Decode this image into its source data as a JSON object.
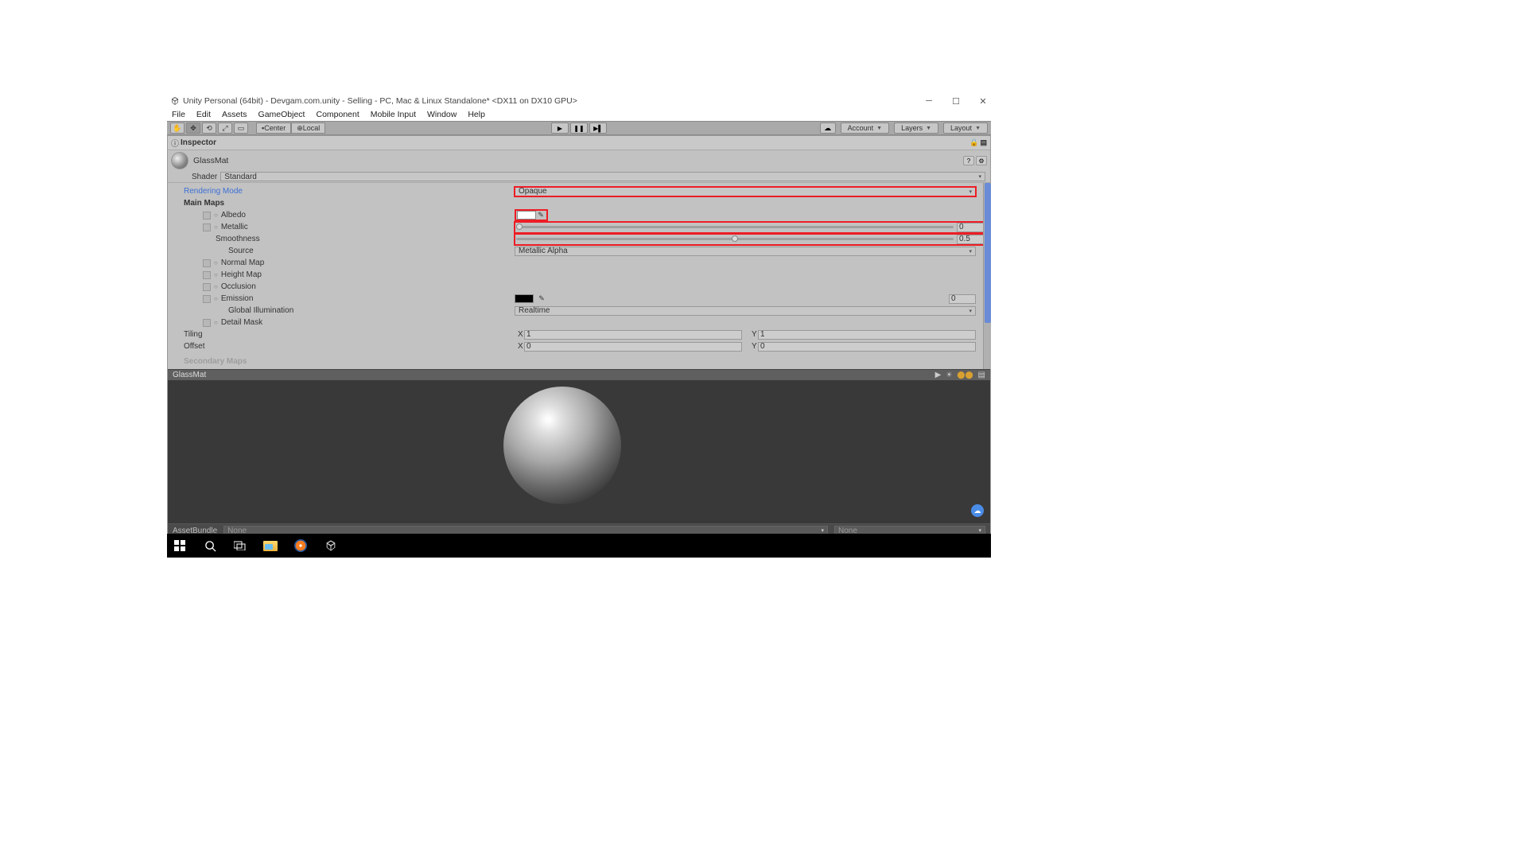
{
  "window": {
    "title": "Unity Personal (64bit) - Devgam.com.unity - Selling - PC, Mac & Linux Standalone* <DX11 on DX10 GPU>"
  },
  "menubar": [
    "File",
    "Edit",
    "Assets",
    "GameObject",
    "Component",
    "Mobile Input",
    "Window",
    "Help"
  ],
  "toolbar": {
    "center": "Center",
    "local": "Local",
    "account": "Account",
    "layers": "Layers",
    "layout": "Layout"
  },
  "inspector": {
    "title": "Inspector",
    "material_name": "GlassMat",
    "shader_label": "Shader",
    "shader_value": "Standard",
    "rendering_mode_label": "Rendering Mode",
    "rendering_mode_value": "Opaque",
    "main_maps": "Main Maps",
    "albedo": "Albedo",
    "albedo_color": "#ffffff",
    "metallic": "Metallic",
    "metallic_value": "0",
    "smoothness": "Smoothness",
    "smoothness_value": "0.5",
    "source": "Source",
    "source_value": "Metallic Alpha",
    "normal_map": "Normal Map",
    "height_map": "Height Map",
    "occlusion": "Occlusion",
    "emission": "Emission",
    "emission_color": "#000000",
    "emission_value": "0",
    "global_illumination": "Global Illumination",
    "global_illumination_value": "Realtime",
    "detail_mask": "Detail Mask",
    "tiling": "Tiling",
    "tiling_x": "1",
    "tiling_y": "1",
    "offset": "Offset",
    "offset_x": "0",
    "offset_y": "0",
    "secondary_maps": "Secondary Maps"
  },
  "preview": {
    "title": "GlassMat"
  },
  "assetbundle": {
    "label": "AssetBundle",
    "value1": "None",
    "value2": "None"
  }
}
